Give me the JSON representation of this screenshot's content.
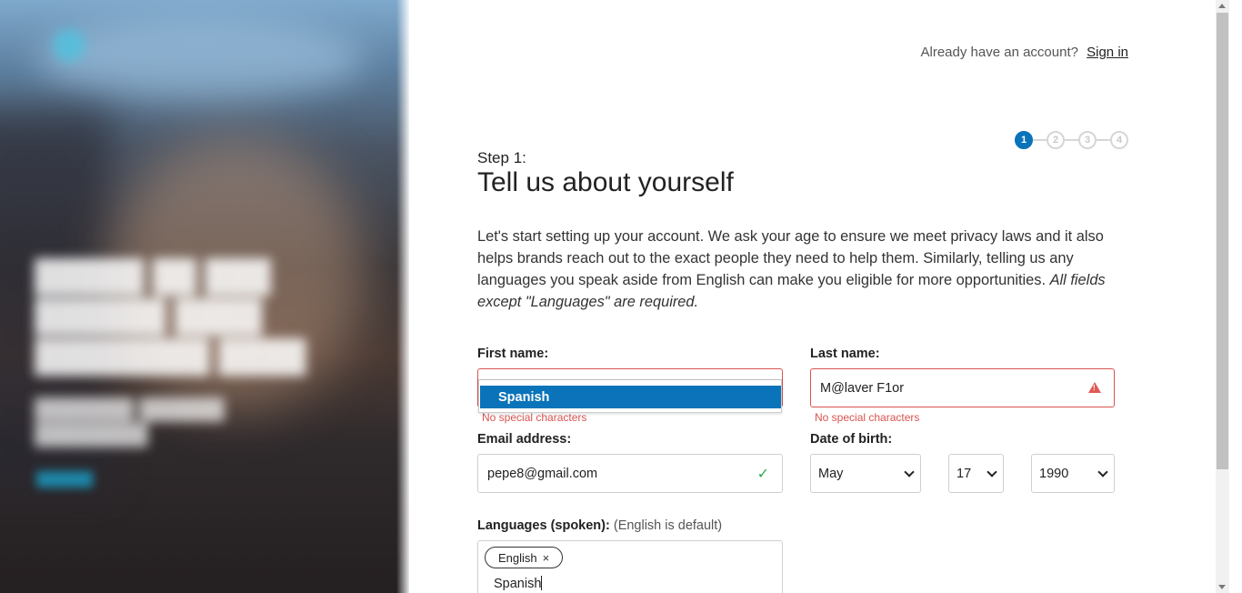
{
  "signin": {
    "prompt": "Already have an account?",
    "link": "Sign in"
  },
  "stepper": {
    "steps": [
      "1",
      "2",
      "3",
      "4"
    ],
    "active_index": 0
  },
  "step_label": "Step 1:",
  "title": "Tell us about yourself",
  "intro": {
    "text": "Let's start setting up your account. We ask your age to ensure we meet privacy laws and it also helps brands reach out to the exact people they need to help them. Similarly, telling us any languages you speak aside from English can make you eligible for more opportunities.",
    "emphasis": "All fields except \"Languages\" are required."
  },
  "form": {
    "first_name": {
      "label": "First name:",
      "value": "",
      "error": "No special characters",
      "autocomplete": [
        "Spanish"
      ]
    },
    "last_name": {
      "label": "Last name:",
      "value": "M@laver F1or",
      "error": "No special characters"
    },
    "email": {
      "label": "Email address:",
      "value": "pepe8@gmail.com"
    },
    "dob": {
      "label": "Date of birth:",
      "month": "May",
      "day": "17",
      "year": "1990"
    },
    "languages": {
      "label": "Languages (spoken):",
      "hint": "(English is default)",
      "chips": [
        "English"
      ],
      "input_value": "Spanish"
    }
  },
  "colors": {
    "accent": "#0a73b9",
    "error": "#d9534f",
    "success": "#2eaa55"
  }
}
